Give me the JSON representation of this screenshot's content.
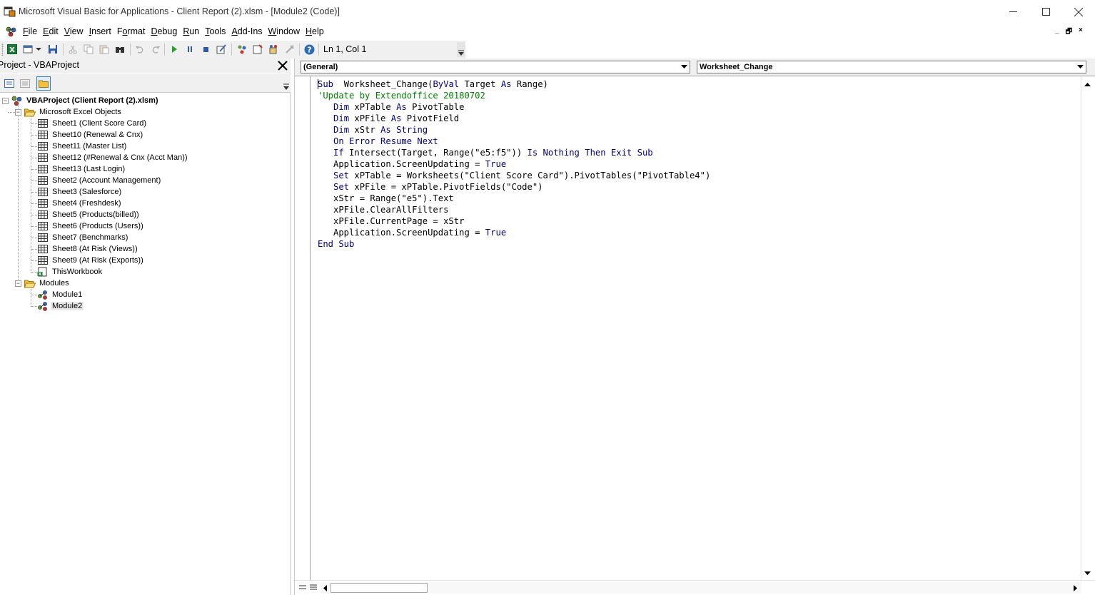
{
  "window": {
    "title": "Microsoft Visual Basic for Applications - Client Report  (2).xlsm - [Module2 (Code)]",
    "minimize_icon": "minimize-icon",
    "maximize_icon": "maximize-icon",
    "close_icon": "close-icon"
  },
  "menubar": {
    "items": [
      {
        "label": "File",
        "accel": "F"
      },
      {
        "label": "Edit",
        "accel": "E"
      },
      {
        "label": "View",
        "accel": "V"
      },
      {
        "label": "Insert",
        "accel": "I"
      },
      {
        "label": "Format",
        "accel": "o"
      },
      {
        "label": "Debug",
        "accel": "D"
      },
      {
        "label": "Run",
        "accel": "R"
      },
      {
        "label": "Tools",
        "accel": "T"
      },
      {
        "label": "Add-Ins",
        "accel": "A"
      },
      {
        "label": "Window",
        "accel": "W"
      },
      {
        "label": "Help",
        "accel": "H"
      }
    ],
    "mdi": {
      "minimize": "_",
      "restore": "🗗",
      "close": "×"
    }
  },
  "toolbar": {
    "status": "Ln 1, Col 1"
  },
  "project": {
    "title": "Project - VBAProject",
    "close_label": "✕",
    "tree": {
      "root": "VBAProject (Client Report  (2).xlsm)",
      "excel_objects_folder": "Microsoft Excel Objects",
      "sheets": [
        "Sheet1 (Client Score Card)",
        "Sheet10 (Renewal & Cnx)",
        "Sheet11 (Master List)",
        "Sheet12 (#Renewal & Cnx (Acct Man))",
        "Sheet13 (Last Login)",
        "Sheet2 (Account Management)",
        "Sheet3 (Salesforce)",
        "Sheet4 (Freshdesk)",
        "Sheet5 (Products(billed))",
        "Sheet6 (Products (Users))",
        "Sheet7 (Benchmarks)",
        "Sheet8 (At Risk (Views))",
        "Sheet9 (At Risk (Exports))"
      ],
      "workbook": "ThisWorkbook",
      "modules_folder": "Modules",
      "modules": [
        "Module1",
        "Module2"
      ],
      "selected": "Module2"
    }
  },
  "code": {
    "object_combo": "(General)",
    "procedure_combo": "Worksheet_Change",
    "lines": [
      [
        [
          "kw",
          "Sub"
        ],
        [
          "",
          "  Worksheet_Change("
        ],
        [
          "kw",
          "ByVal"
        ],
        [
          "",
          " Target "
        ],
        [
          "kw",
          "As"
        ],
        [
          "",
          " Range)"
        ]
      ],
      [
        [
          "cm",
          "'Update by Extendoffice 20180702"
        ]
      ],
      [
        [
          "",
          "   "
        ],
        [
          "kw",
          "Dim"
        ],
        [
          "",
          " xPTable "
        ],
        [
          "kw",
          "As"
        ],
        [
          "",
          " PivotTable"
        ]
      ],
      [
        [
          "",
          "   "
        ],
        [
          "kw",
          "Dim"
        ],
        [
          "",
          " xPFile "
        ],
        [
          "kw",
          "As"
        ],
        [
          "",
          " PivotField"
        ]
      ],
      [
        [
          "",
          "   "
        ],
        [
          "kw",
          "Dim"
        ],
        [
          "",
          " xStr "
        ],
        [
          "kw",
          "As"
        ],
        [
          "",
          " "
        ],
        [
          "kw",
          "String"
        ]
      ],
      [
        [
          "",
          "   "
        ],
        [
          "kw",
          "On Error Resume Next"
        ]
      ],
      [
        [
          "",
          "   "
        ],
        [
          "kw",
          "If"
        ],
        [
          "",
          " Intersect(Target, Range(\"e5:f5\")) "
        ],
        [
          "kw",
          "Is Nothing Then Exit Sub"
        ]
      ],
      [
        [
          "",
          "   Application.ScreenUpdating = "
        ],
        [
          "kw",
          "True"
        ]
      ],
      [
        [
          "",
          "   "
        ],
        [
          "kw",
          "Set"
        ],
        [
          "",
          " xPTable = Worksheets(\"Client Score Card\").PivotTables(\"PivotTable4\")"
        ]
      ],
      [
        [
          "",
          "   "
        ],
        [
          "kw",
          "Set"
        ],
        [
          "",
          " xPFile = xPTable.PivotFields(\"Code\")"
        ]
      ],
      [
        [
          "",
          "   xStr = Range(\"e5\").Text"
        ]
      ],
      [
        [
          "",
          "   xPFile.ClearAllFilters"
        ]
      ],
      [
        [
          "",
          "   xPFile.CurrentPage = xStr"
        ]
      ],
      [
        [
          "",
          "   Application.ScreenUpdating = "
        ],
        [
          "kw",
          "True"
        ]
      ],
      [
        [
          "kw",
          "End Sub"
        ]
      ]
    ]
  },
  "colors": {
    "keyword": "#00007f",
    "comment": "#008000",
    "chrome": "#f0f0f0"
  }
}
